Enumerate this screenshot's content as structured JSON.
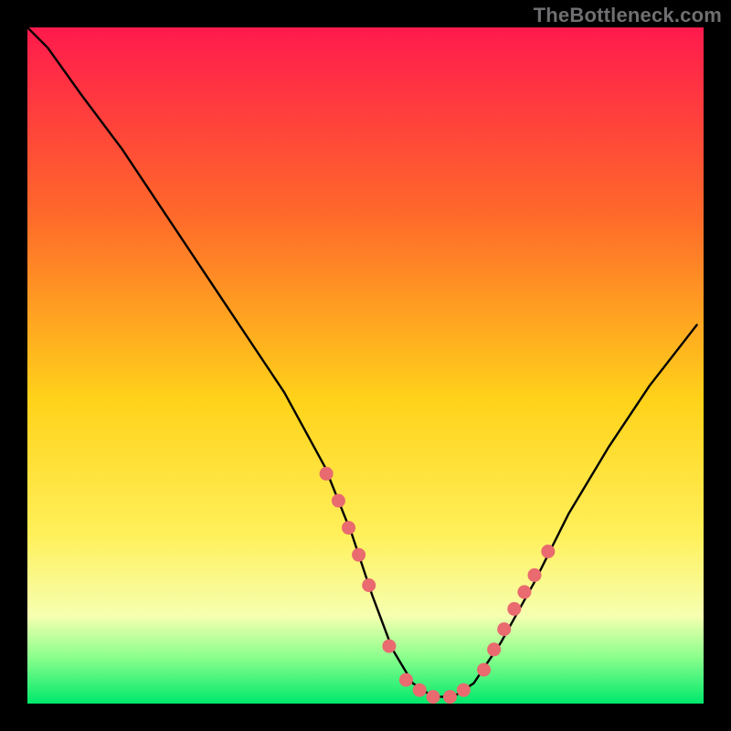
{
  "watermark": "TheBottleneck.com",
  "colors": {
    "background": "#000000",
    "gradient_top": "#ff1a4d",
    "gradient_mid_upper": "#ff6a2a",
    "gradient_mid": "#ffd21a",
    "gradient_low": "#fff05a",
    "gradient_pale": "#f6ffb0",
    "gradient_green_soft": "#8dff8d",
    "gradient_green": "#00e86b",
    "curve": "#000000",
    "marker_fill": "#e96a6f",
    "marker_stroke": "#d44a50"
  },
  "chart_data": {
    "type": "line",
    "title": "",
    "xlabel": "",
    "ylabel": "",
    "xlim": [
      0,
      100
    ],
    "ylim": [
      0,
      100
    ],
    "grid": false,
    "legend": false,
    "series": [
      {
        "name": "bottleneck-curve",
        "x": [
          0,
          3,
          8,
          14,
          20,
          26,
          32,
          38,
          44,
          48,
          51,
          54,
          57,
          60,
          63,
          66,
          70,
          75,
          80,
          86,
          92,
          99
        ],
        "y": [
          100,
          97,
          90,
          82,
          73,
          64,
          55,
          46,
          35,
          25,
          16,
          8,
          3,
          1,
          1,
          3,
          9,
          18,
          28,
          38,
          47,
          56
        ]
      }
    ],
    "markers": {
      "name": "highlighted-points",
      "x": [
        44.2,
        46.0,
        47.5,
        49.0,
        50.5,
        53.5,
        56.0,
        58.0,
        60.0,
        62.5,
        64.5,
        67.5,
        69.0,
        70.5,
        72.0,
        73.5,
        75.0,
        77.0
      ],
      "y": [
        34.0,
        30.0,
        26.0,
        22.0,
        17.5,
        8.5,
        3.5,
        2.0,
        1.0,
        1.0,
        2.0,
        5.0,
        8.0,
        11.0,
        14.0,
        16.5,
        19.0,
        22.5
      ]
    }
  }
}
